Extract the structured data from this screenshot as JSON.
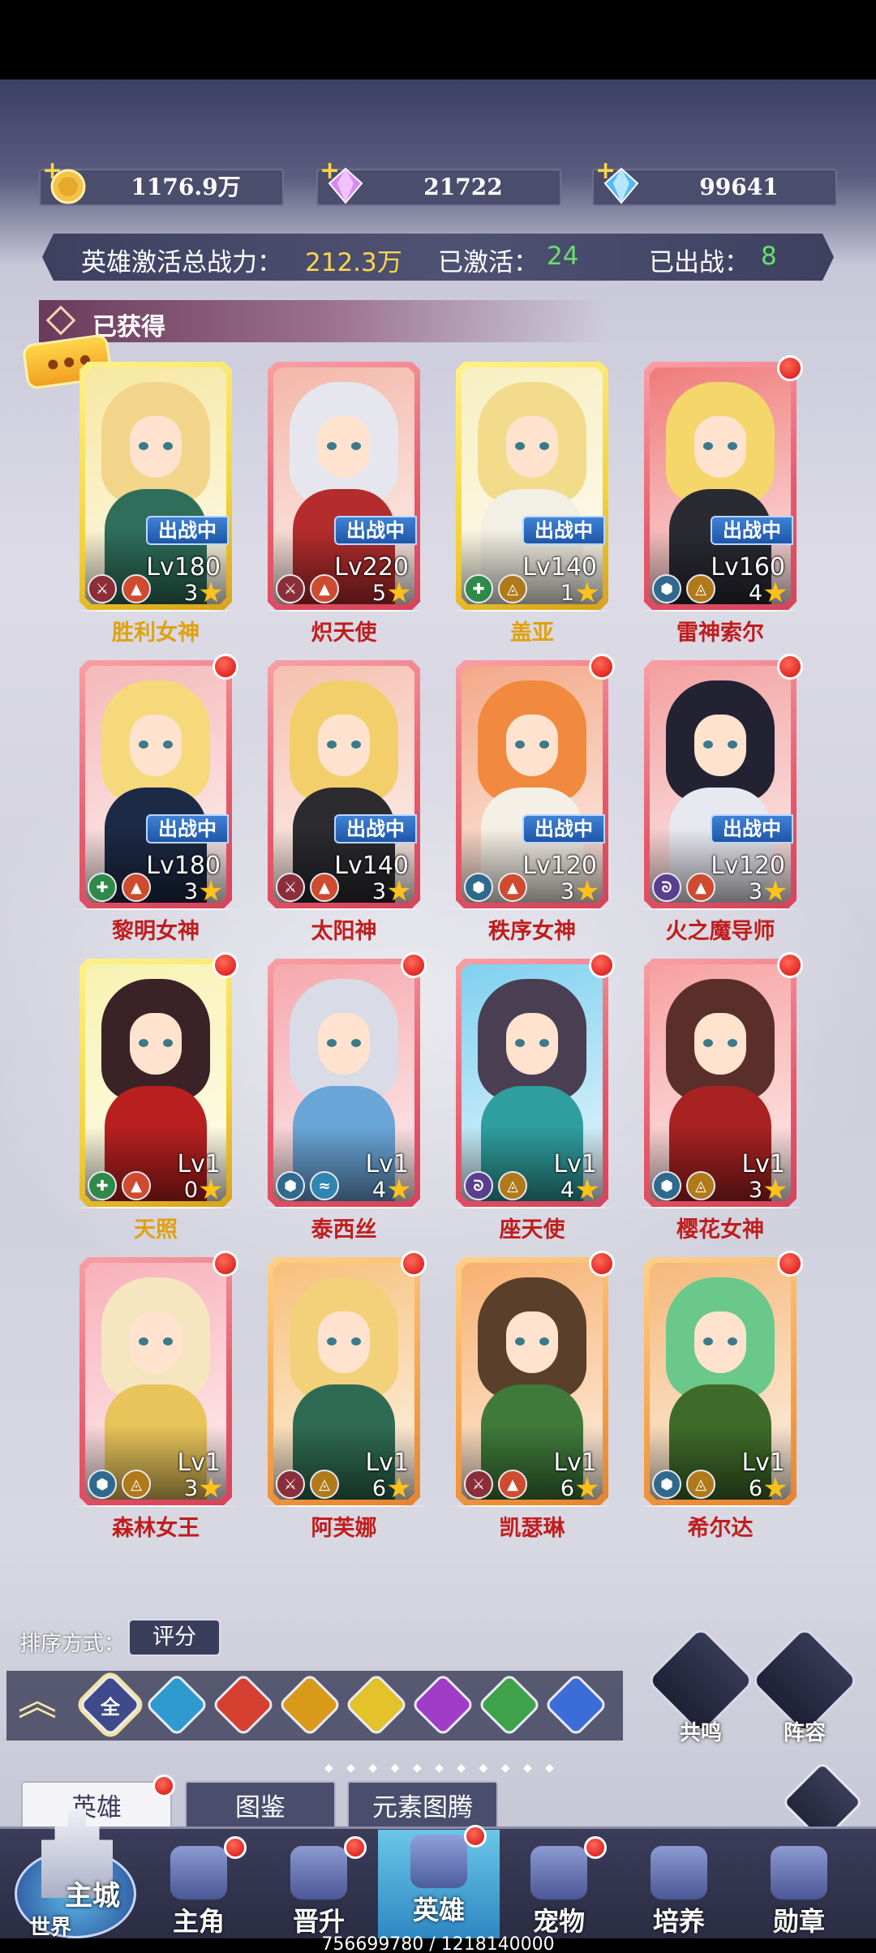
{
  "currency": {
    "gold": "1176.9万",
    "diamond_pink": "21722",
    "diamond_blue": "99641"
  },
  "power": {
    "label": "英雄激活总战力：",
    "value": "212.3万",
    "activated_label": "已激活：",
    "activated_value": "24",
    "deployed_label": "已出战：",
    "deployed_value": "8"
  },
  "section_title": "已获得",
  "deployed_badge": "出战中",
  "heroes": [
    {
      "name": "胜利女神",
      "level": "Lv180",
      "stars": "3",
      "deployed": true,
      "frame": "gold",
      "name_color": "gold",
      "red_dot": false,
      "elements": [
        "sword",
        "fire"
      ]
    },
    {
      "name": "炽天使",
      "level": "Lv220",
      "stars": "5",
      "deployed": true,
      "frame": "pink",
      "name_color": "red",
      "red_dot": false,
      "elements": [
        "sword",
        "fire"
      ]
    },
    {
      "name": "盖亚",
      "level": "Lv140",
      "stars": "1",
      "deployed": true,
      "frame": "gold",
      "name_color": "gold",
      "red_dot": false,
      "elements": [
        "cross",
        "earth"
      ]
    },
    {
      "name": "雷神索尔",
      "level": "Lv160",
      "stars": "4",
      "deployed": true,
      "frame": "pink",
      "name_color": "red",
      "red_dot": true,
      "elements": [
        "shield",
        "earth"
      ]
    },
    {
      "name": "黎明女神",
      "level": "Lv180",
      "stars": "3",
      "deployed": true,
      "frame": "pink",
      "name_color": "red",
      "red_dot": true,
      "elements": [
        "cross",
        "fire"
      ]
    },
    {
      "name": "太阳神",
      "level": "Lv140",
      "stars": "3",
      "deployed": true,
      "frame": "pink",
      "name_color": "red",
      "red_dot": false,
      "elements": [
        "sword",
        "fire"
      ]
    },
    {
      "name": "秩序女神",
      "level": "Lv120",
      "stars": "3",
      "deployed": true,
      "frame": "pink",
      "name_color": "red",
      "red_dot": true,
      "elements": [
        "shield",
        "fire"
      ]
    },
    {
      "name": "火之魔导师",
      "level": "Lv120",
      "stars": "3",
      "deployed": true,
      "frame": "pink",
      "name_color": "red",
      "red_dot": true,
      "elements": [
        "magic",
        "fire"
      ]
    },
    {
      "name": "天照",
      "level": "Lv1",
      "stars": "0",
      "deployed": false,
      "frame": "gold",
      "name_color": "gold",
      "red_dot": true,
      "elements": [
        "cross",
        "fire"
      ]
    },
    {
      "name": "泰西丝",
      "level": "Lv1",
      "stars": "4",
      "deployed": false,
      "frame": "pink",
      "name_color": "red",
      "red_dot": true,
      "elements": [
        "shield",
        "water"
      ]
    },
    {
      "name": "座天使",
      "level": "Lv1",
      "stars": "4",
      "deployed": false,
      "frame": "pink",
      "name_color": "red",
      "red_dot": true,
      "elements": [
        "magic",
        "earth"
      ]
    },
    {
      "name": "樱花女神",
      "level": "Lv1",
      "stars": "3",
      "deployed": false,
      "frame": "pink",
      "name_color": "red",
      "red_dot": true,
      "elements": [
        "shield",
        "earth"
      ]
    },
    {
      "name": "森林女王",
      "level": "Lv1",
      "stars": "3",
      "deployed": false,
      "frame": "pink",
      "name_color": "red",
      "red_dot": true,
      "elements": [
        "shield",
        "earth"
      ]
    },
    {
      "name": "阿芙娜",
      "level": "Lv1",
      "stars": "6",
      "deployed": false,
      "frame": "orange",
      "name_color": "red",
      "red_dot": true,
      "elements": [
        "sword",
        "earth"
      ]
    },
    {
      "name": "凯瑟琳",
      "level": "Lv1",
      "stars": "6",
      "deployed": false,
      "frame": "orange",
      "name_color": "red",
      "red_dot": true,
      "elements": [
        "sword",
        "fire"
      ]
    },
    {
      "name": "希尔达",
      "level": "Lv1",
      "stars": "6",
      "deployed": false,
      "frame": "orange",
      "name_color": "red",
      "red_dot": true,
      "elements": [
        "shield",
        "earth"
      ]
    }
  ],
  "sort": {
    "label": "排序方式：",
    "value": "评分"
  },
  "filters": [
    {
      "label": "全",
      "icon": "all-icon",
      "color": "#3f4a8a"
    },
    {
      "label": "",
      "icon": "water-icon",
      "color": "#2e9bd0"
    },
    {
      "label": "",
      "icon": "fire-icon",
      "color": "#d64030"
    },
    {
      "label": "",
      "icon": "earth-icon",
      "color": "#d99a1a"
    },
    {
      "label": "",
      "icon": "light-icon",
      "color": "#e3c22a"
    },
    {
      "label": "",
      "icon": "dark-icon",
      "color": "#a03cc8"
    },
    {
      "label": "",
      "icon": "nature-icon",
      "color": "#3ea24a"
    },
    {
      "label": "",
      "icon": "star-icon",
      "color": "#3c6cd8"
    }
  ],
  "side_buttons": {
    "resonance": "共鸣",
    "lineup": "阵容"
  },
  "tabs": [
    "英雄",
    "图鉴",
    "元素图腾"
  ],
  "nav": {
    "city_label": "主城",
    "world_label": "世界",
    "items": [
      "主角",
      "晋升",
      "英雄",
      "宠物",
      "培养",
      "勋章"
    ]
  },
  "footer_numbers": "756699780 / 1218140000"
}
